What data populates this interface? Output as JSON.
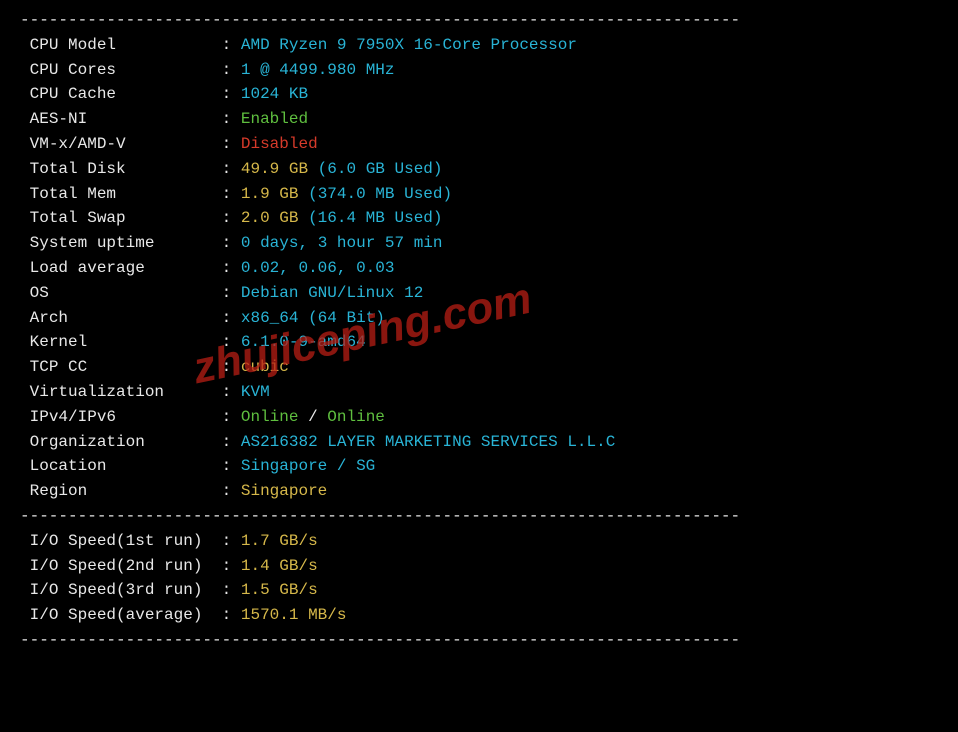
{
  "dash_line": "---------------------------------------------------------------------------",
  "rows": [
    {
      "label": "CPU Model",
      "value": [
        {
          "t": "AMD Ryzen 9 7950X 16-Core Processor",
          "c": "cyan"
        }
      ]
    },
    {
      "label": "CPU Cores",
      "value": [
        {
          "t": "1 @ 4499.980 MHz",
          "c": "cyan"
        }
      ]
    },
    {
      "label": "CPU Cache",
      "value": [
        {
          "t": "1024 KB",
          "c": "cyan"
        }
      ]
    },
    {
      "label": "AES-NI",
      "value": [
        {
          "t": "Enabled",
          "c": "green"
        }
      ]
    },
    {
      "label": "VM-x/AMD-V",
      "value": [
        {
          "t": "Disabled",
          "c": "red"
        }
      ]
    },
    {
      "label": "Total Disk",
      "value": [
        {
          "t": "49.9 ",
          "c": "yellow"
        },
        {
          "t": "GB",
          "c": "yellow"
        },
        {
          "t": " (6.0 GB Used)",
          "c": "cyan"
        }
      ]
    },
    {
      "label": "Total Mem",
      "value": [
        {
          "t": "1.9 ",
          "c": "yellow"
        },
        {
          "t": "GB",
          "c": "yellow"
        },
        {
          "t": " (374.0 MB Used)",
          "c": "cyan"
        }
      ]
    },
    {
      "label": "Total Swap",
      "value": [
        {
          "t": "2.0 ",
          "c": "yellow"
        },
        {
          "t": "GB",
          "c": "yellow"
        },
        {
          "t": " (16.4 MB Used)",
          "c": "cyan"
        }
      ]
    },
    {
      "label": "System uptime",
      "value": [
        {
          "t": "0 days, 3 hour 57 min",
          "c": "cyan"
        }
      ]
    },
    {
      "label": "Load average",
      "value": [
        {
          "t": "0.02, 0.06, 0.03",
          "c": "cyan"
        }
      ]
    },
    {
      "label": "OS",
      "value": [
        {
          "t": "Debian GNU/Linux 12",
          "c": "cyan"
        }
      ]
    },
    {
      "label": "Arch",
      "value": [
        {
          "t": "x86_64 (64 Bit)",
          "c": "cyan"
        }
      ]
    },
    {
      "label": "Kernel",
      "value": [
        {
          "t": "6.1.0-9-amd64",
          "c": "cyan"
        }
      ]
    },
    {
      "label": "TCP CC",
      "value": [
        {
          "t": "cubic",
          "c": "yellow"
        }
      ]
    },
    {
      "label": "Virtualization",
      "value": [
        {
          "t": "KVM",
          "c": "cyan"
        }
      ]
    },
    {
      "label": "IPv4/IPv6",
      "value": [
        {
          "t": "Online",
          "c": "green"
        },
        {
          "t": " / ",
          "c": "white"
        },
        {
          "t": "Online",
          "c": "green"
        }
      ]
    },
    {
      "label": "Organization",
      "value": [
        {
          "t": "AS216382 LAYER MARKETING SERVICES L.L.C",
          "c": "cyan"
        }
      ]
    },
    {
      "label": "Location",
      "value": [
        {
          "t": "Singapore / SG",
          "c": "cyan"
        }
      ]
    },
    {
      "label": "Region",
      "value": [
        {
          "t": "Singapore",
          "c": "yellow"
        }
      ]
    }
  ],
  "io_rows": [
    {
      "label": "I/O Speed(1st run)",
      "value": [
        {
          "t": "1.7 ",
          "c": "yellow"
        },
        {
          "t": "GB/s",
          "c": "yellow"
        }
      ]
    },
    {
      "label": "I/O Speed(2nd run)",
      "value": [
        {
          "t": "1.4 ",
          "c": "yellow"
        },
        {
          "t": "GB/s",
          "c": "yellow"
        }
      ]
    },
    {
      "label": "I/O Speed(3rd run)",
      "value": [
        {
          "t": "1.5 ",
          "c": "yellow"
        },
        {
          "t": "GB/s",
          "c": "yellow"
        }
      ]
    },
    {
      "label": "I/O Speed(average)",
      "value": [
        {
          "t": "1570.1 ",
          "c": "yellow"
        },
        {
          "t": "MB/s",
          "c": "yellow"
        }
      ]
    }
  ],
  "watermark": "zhujiceping.com"
}
